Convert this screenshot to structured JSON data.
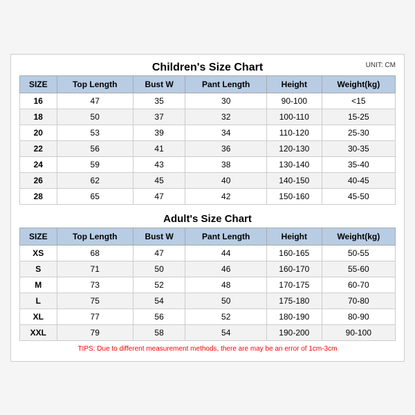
{
  "mainTitle": "Children's Size Chart",
  "unitLabel": "UNIT: CM",
  "children": {
    "headers": [
      "SIZE",
      "Top Length",
      "Bust W",
      "Pant Length",
      "Height",
      "Weight(kg)"
    ],
    "rows": [
      [
        "16",
        "47",
        "35",
        "30",
        "90-100",
        "<15"
      ],
      [
        "18",
        "50",
        "37",
        "32",
        "100-110",
        "15-25"
      ],
      [
        "20",
        "53",
        "39",
        "34",
        "110-120",
        "25-30"
      ],
      [
        "22",
        "56",
        "41",
        "36",
        "120-130",
        "30-35"
      ],
      [
        "24",
        "59",
        "43",
        "38",
        "130-140",
        "35-40"
      ],
      [
        "26",
        "62",
        "45",
        "40",
        "140-150",
        "40-45"
      ],
      [
        "28",
        "65",
        "47",
        "42",
        "150-160",
        "45-50"
      ]
    ]
  },
  "adultsTitle": "Adult's Size Chart",
  "adults": {
    "headers": [
      "SIZE",
      "Top Length",
      "Bust W",
      "Pant Length",
      "Height",
      "Weight(kg)"
    ],
    "rows": [
      [
        "XS",
        "68",
        "47",
        "44",
        "160-165",
        "50-55"
      ],
      [
        "S",
        "71",
        "50",
        "46",
        "160-170",
        "55-60"
      ],
      [
        "M",
        "73",
        "52",
        "48",
        "170-175",
        "60-70"
      ],
      [
        "L",
        "75",
        "54",
        "50",
        "175-180",
        "70-80"
      ],
      [
        "XL",
        "77",
        "56",
        "52",
        "180-190",
        "80-90"
      ],
      [
        "XXL",
        "79",
        "58",
        "54",
        "190-200",
        "90-100"
      ]
    ]
  },
  "tips": "TIPS: Due to different measurement methods, there are may be an error of 1cm-3cm"
}
